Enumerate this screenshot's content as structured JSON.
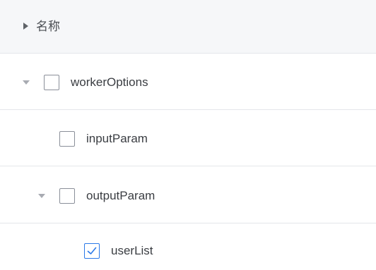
{
  "header": {
    "column_label": "名称"
  },
  "tree": {
    "nodes": [
      {
        "label": "workerOptions",
        "expanded": true,
        "checked": false,
        "level": 0
      },
      {
        "label": "inputParam",
        "expanded": false,
        "checked": false,
        "level": 1,
        "has_children": false
      },
      {
        "label": "outputParam",
        "expanded": true,
        "checked": false,
        "level": 1
      },
      {
        "label": "userList",
        "expanded": false,
        "checked": true,
        "level": 2,
        "has_children": false
      }
    ]
  },
  "colors": {
    "header_bg": "#f6f7f9",
    "divider": "#e4e6ea",
    "checkbox_border": "#8a8f99",
    "checked_accent": "#2b79e8",
    "text": "#3a3d42"
  }
}
